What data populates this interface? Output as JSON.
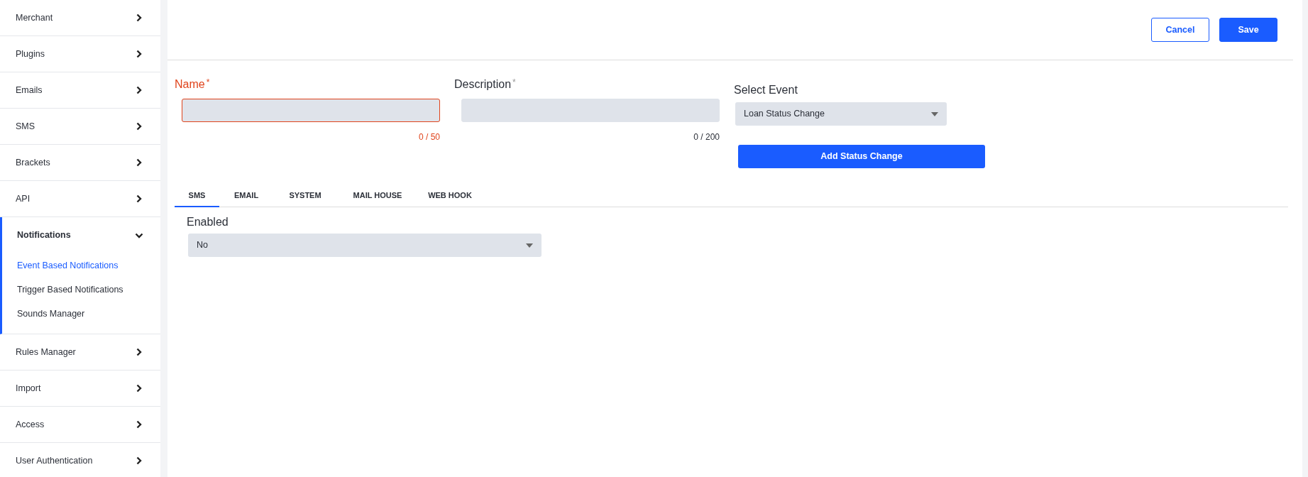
{
  "sidebar": {
    "items": [
      {
        "label": "Merchant",
        "expanded": false
      },
      {
        "label": "Plugins",
        "expanded": false
      },
      {
        "label": "Emails",
        "expanded": false
      },
      {
        "label": "SMS",
        "expanded": false
      },
      {
        "label": "Brackets",
        "expanded": false
      },
      {
        "label": "API",
        "expanded": false
      },
      {
        "label": "Notifications",
        "expanded": true,
        "children": [
          {
            "label": "Event Based Notifications",
            "selected": true
          },
          {
            "label": "Trigger Based Notifications",
            "selected": false
          },
          {
            "label": "Sounds Manager",
            "selected": false
          }
        ]
      },
      {
        "label": "Rules Manager",
        "expanded": false
      },
      {
        "label": "Import",
        "expanded": false
      },
      {
        "label": "Access",
        "expanded": false
      },
      {
        "label": "User Authentication",
        "expanded": false
      }
    ]
  },
  "header": {
    "buttons": [
      {
        "label": "Cancel",
        "kind": "outline"
      },
      {
        "label": "Save",
        "kind": "primary"
      }
    ]
  },
  "form": {
    "fields": [
      {
        "label": "Name",
        "required": "*",
        "invalid": true,
        "counter": "0 / 50"
      },
      {
        "label": "Description",
        "required": "*",
        "invalid": false,
        "counter": "0 / 200"
      }
    ],
    "select_event": {
      "label": "Select Event",
      "value": "Loan Status Change"
    },
    "add_button": "Add Status Change"
  },
  "tabs": [
    {
      "label": "SMS",
      "selected": true
    },
    {
      "label": "EMAIL",
      "selected": false
    },
    {
      "label": "SYSTEM",
      "selected": false
    },
    {
      "label": "MAIL HOUSE",
      "selected": false
    },
    {
      "label": "WEB HOOK",
      "selected": false
    }
  ],
  "enabled": {
    "label": "Enabled",
    "value": "No"
  }
}
